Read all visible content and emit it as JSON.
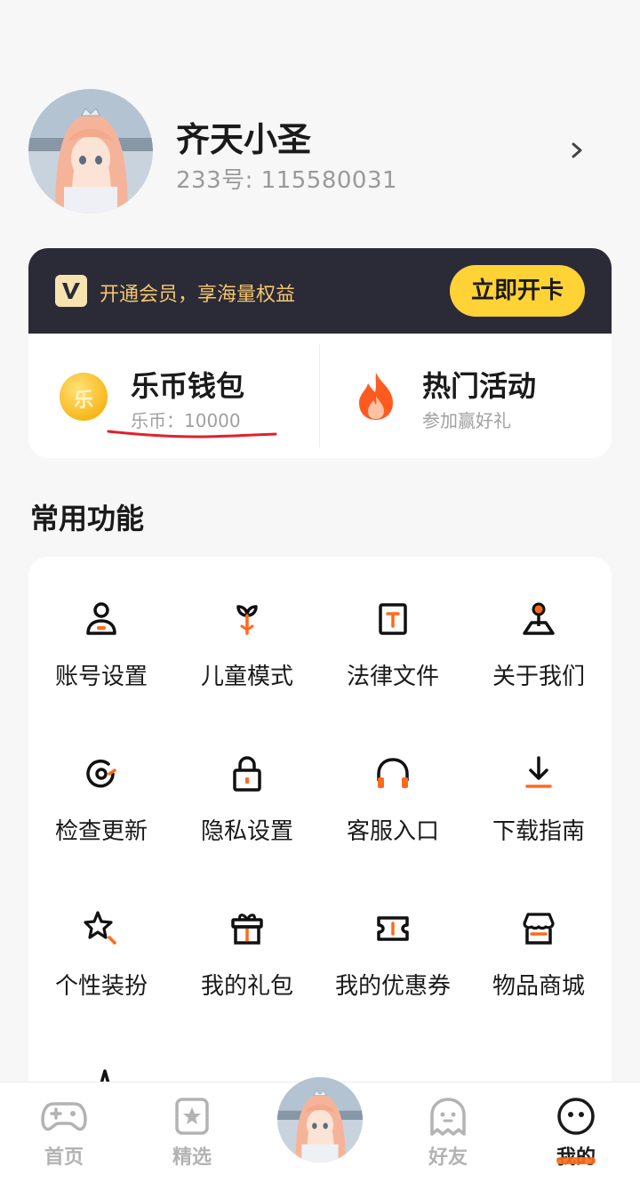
{
  "profile": {
    "name": "齐天小圣",
    "uid": "233号: 115580031"
  },
  "vip": {
    "promo_text": "开通会员，享海量权益",
    "button_label": "立即开卡"
  },
  "wallet": {
    "title": "乐币钱包",
    "subtitle": "乐币：10000",
    "coin_glyph": "乐"
  },
  "activity": {
    "title": "热门活动",
    "subtitle": "参加赢好礼"
  },
  "functions": {
    "section_title": "常用功能",
    "items": [
      {
        "label": "账号设置",
        "icon": "user-icon"
      },
      {
        "label": "儿童模式",
        "icon": "sprout-icon"
      },
      {
        "label": "法律文件",
        "icon": "document-icon"
      },
      {
        "label": "关于我们",
        "icon": "map-pin-icon"
      },
      {
        "label": "检查更新",
        "icon": "refresh-icon"
      },
      {
        "label": "隐私设置",
        "icon": "lock-icon"
      },
      {
        "label": "客服入口",
        "icon": "headset-icon"
      },
      {
        "label": "下载指南",
        "icon": "download-icon"
      },
      {
        "label": "个性装扮",
        "icon": "star-wand-icon"
      },
      {
        "label": "我的礼包",
        "icon": "gift-icon"
      },
      {
        "label": "我的优惠券",
        "icon": "coupon-icon"
      },
      {
        "label": "物品商城",
        "icon": "store-icon"
      }
    ]
  },
  "nav": {
    "items": [
      {
        "label": "首页",
        "icon": "gamepad-icon",
        "active": false
      },
      {
        "label": "精选",
        "icon": "star-badge-icon",
        "active": false
      },
      {
        "label": "好友",
        "icon": "ghost-icon",
        "active": false
      },
      {
        "label": "我的",
        "icon": "smile-face-icon",
        "active": true
      }
    ]
  },
  "colors": {
    "accent": "#ff6a1a",
    "vip_bar": "#2b2a37",
    "vip_button": "#ffd236",
    "vip_text": "#f3c66e"
  }
}
